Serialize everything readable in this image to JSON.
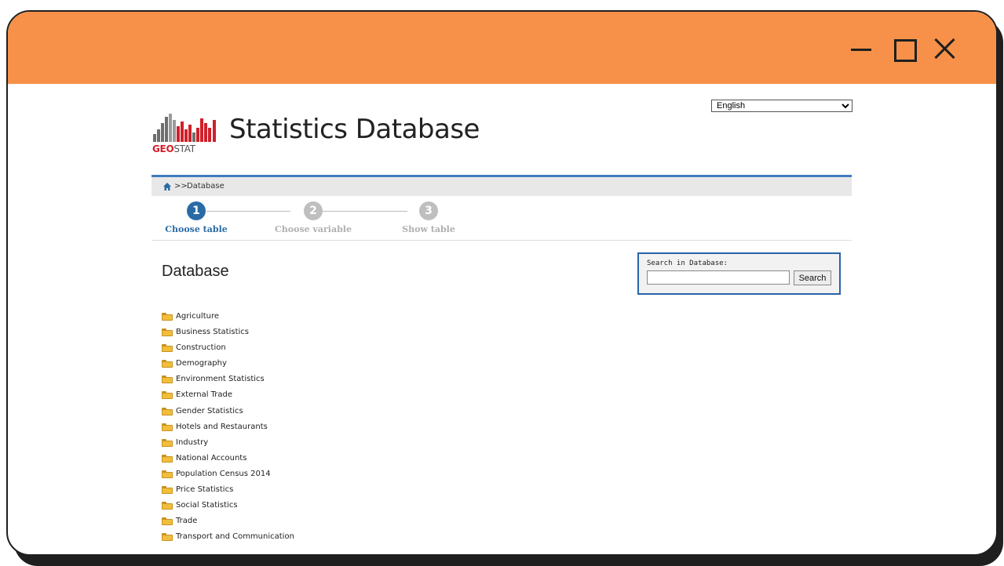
{
  "window": {
    "minimize_icon": "minimize-icon",
    "maximize_icon": "maximize-icon",
    "close_icon": "close-icon",
    "titlebar_color": "#f79149"
  },
  "header": {
    "language_selected": "English",
    "logo_geo": "GEO",
    "logo_stat": "STAT",
    "site_title": "Statistics Database"
  },
  "breadcrumb": {
    "home_icon": "home-icon",
    "separator": ">>",
    "current": "Database"
  },
  "steps": [
    {
      "number": "1",
      "label": "Choose table",
      "active": true
    },
    {
      "number": "2",
      "label": "Choose variable",
      "active": false
    },
    {
      "number": "3",
      "label": "Show table",
      "active": false
    }
  ],
  "main": {
    "heading": "Database",
    "search": {
      "label": "Search in Database:",
      "value": "",
      "button_label": "Search"
    },
    "folders": [
      "Agriculture",
      "Business Statistics",
      "Construction",
      "Demography",
      "Environment Statistics",
      "External Trade",
      "Gender Statistics",
      "Hotels and Restaurants",
      "Industry",
      "National Accounts",
      "Population Census 2014",
      "Price Statistics",
      "Social Statistics",
      "Trade",
      "Transport and Communication"
    ]
  },
  "colors": {
    "accent": "#2a6ba6",
    "logo_red": "#d0202a",
    "folder": "#f0be3c"
  }
}
